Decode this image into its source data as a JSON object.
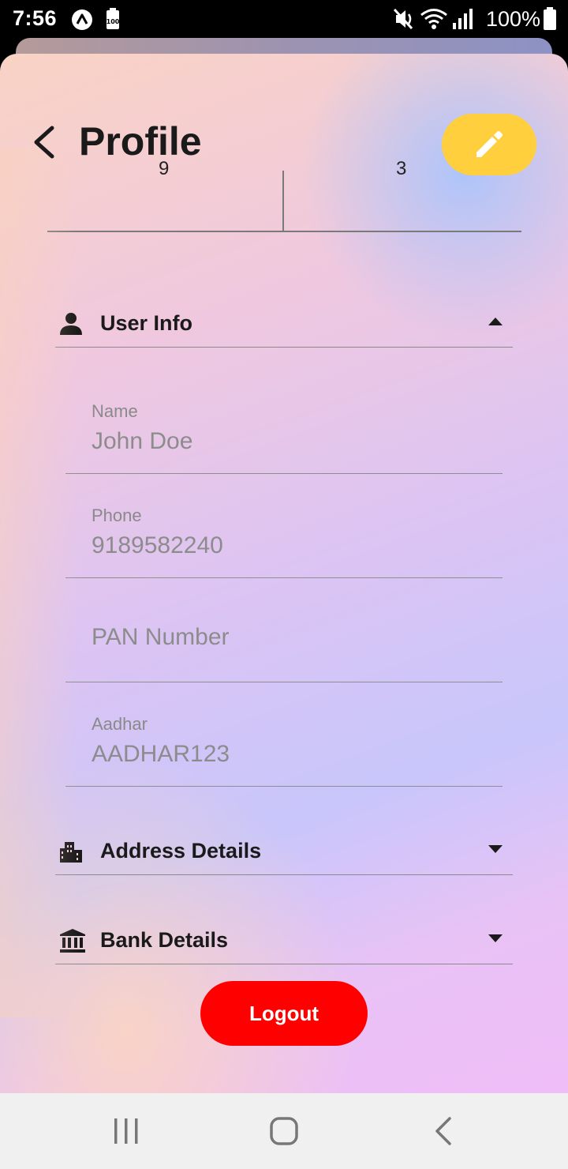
{
  "status_bar": {
    "time": "7:56",
    "battery_text": "100%",
    "icons": [
      "app-a-icon",
      "battery-saver-icon",
      "mute-icon",
      "wifi-icon",
      "signal-icon",
      "battery-icon"
    ]
  },
  "header": {
    "title": "Profile",
    "back_icon": "chevron-left-icon",
    "edit_icon": "pencil-icon",
    "edit_color": "#ffcf3e"
  },
  "stats": {
    "left_value": "9",
    "right_value": "3"
  },
  "sections": {
    "user_info": {
      "title": "User Info",
      "icon": "person-icon",
      "state": "expanded"
    },
    "address": {
      "title": "Address Details",
      "icon": "building-icon",
      "state": "collapsed"
    },
    "bank": {
      "title": "Bank Details",
      "icon": "bank-icon",
      "state": "collapsed"
    }
  },
  "fields": {
    "name": {
      "label": "Name",
      "value": "John Doe"
    },
    "phone": {
      "label": "Phone",
      "value": "9189582240"
    },
    "pan": {
      "placeholder": "PAN Number"
    },
    "aadhar": {
      "label": "Aadhar",
      "value": "AADHAR123"
    }
  },
  "logout": {
    "label": "Logout",
    "color": "#ff0000"
  },
  "nav_bar": {
    "buttons": [
      "recents-icon",
      "home-icon",
      "back-icon"
    ]
  }
}
